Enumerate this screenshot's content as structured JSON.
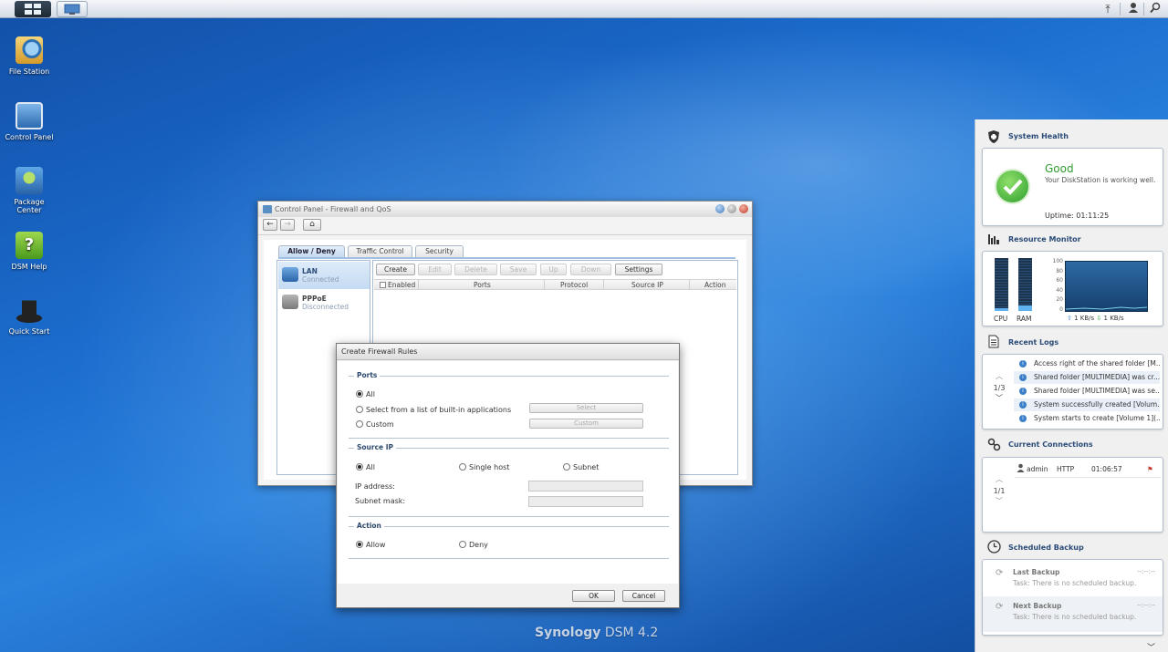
{
  "desktop": {
    "icons": [
      {
        "label": "File Station"
      },
      {
        "label": "Control Panel"
      },
      {
        "label": "Package\nCenter"
      },
      {
        "label": "DSM Help"
      },
      {
        "label": "Quick Start"
      }
    ],
    "branding": {
      "name": "Synology",
      "product": "DSM 4.2"
    }
  },
  "control_panel": {
    "title": "Control Panel - Firewall and QoS",
    "tabs": [
      {
        "label": "Allow / Deny",
        "active": true
      },
      {
        "label": "Traffic Control",
        "active": false
      },
      {
        "label": "Security",
        "active": false
      }
    ],
    "interfaces": [
      {
        "name": "LAN",
        "status": "Connected",
        "selected": true
      },
      {
        "name": "PPPoE",
        "status": "Disconnected",
        "selected": false
      }
    ],
    "toolbar": {
      "create": "Create",
      "edit": "Edit",
      "delete": "Delete",
      "save": "Save",
      "up": "Up",
      "down": "Down",
      "settings": "Settings"
    },
    "columns": [
      "Enabled",
      "Ports",
      "Protocol",
      "Source IP",
      "Action"
    ]
  },
  "dialog": {
    "title": "Create Firewall Rules",
    "ports": {
      "label": "Ports",
      "all": "All",
      "builtin": "Select from a list of built-in applications",
      "custom": "Custom",
      "select_btn": "Select",
      "custom_btn": "Custom",
      "selected": "All"
    },
    "source_ip": {
      "label": "Source IP",
      "all": "All",
      "single": "Single host",
      "subnet": "Subnet",
      "ip_label": "IP address:",
      "mask_label": "Subnet mask:",
      "selected": "All"
    },
    "action": {
      "label": "Action",
      "allow": "Allow",
      "deny": "Deny",
      "selected": "Allow"
    },
    "ok": "OK",
    "cancel": "Cancel"
  },
  "widgets": {
    "health": {
      "title": "System Health",
      "status": "Good",
      "desc": "Your DiskStation is working well.",
      "uptime": "Uptime: 01:11:25"
    },
    "resource": {
      "title": "Resource Monitor",
      "cpu": "CPU",
      "ram": "RAM",
      "cpu_level": 0.05,
      "ram_level": 0.1,
      "y_ticks": [
        "100",
        "80",
        "60",
        "40",
        "20",
        "0"
      ],
      "upload": "1 KB/s",
      "download": "1 KB/s"
    },
    "logs": {
      "title": "Recent Logs",
      "page": "1/3",
      "items": [
        "Access right of the shared folder [M...",
        "Shared folder [MULTIMEDIA] was cr...",
        "Shared folder [MULTIMEDIA] was se...",
        "System successfully created [Volum...",
        "System starts to create [Volume 1](..."
      ]
    },
    "connections": {
      "title": "Current Connections",
      "page": "1/1",
      "user": "admin",
      "type": "HTTP",
      "time": "01:06:57"
    },
    "backup": {
      "title": "Scheduled Backup",
      "last": {
        "label": "Last Backup",
        "task": "Task: There is no scheduled backup.",
        "time": "--:--:--"
      },
      "next": {
        "label": "Next Backup",
        "task": "Task: There is no scheduled backup.",
        "time": "--:--:--"
      }
    }
  },
  "colors": {
    "accent": "#2a4b77",
    "good": "#2e9e2e",
    "desktop": "#1b6ccd"
  }
}
